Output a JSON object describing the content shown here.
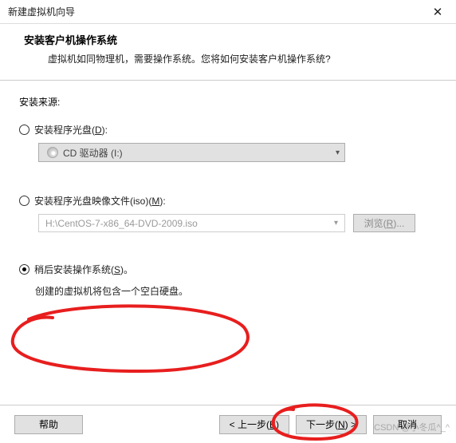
{
  "title": "新建虚拟机向导",
  "header": {
    "heading": "安装客户机操作系统",
    "subhead": "虚拟机如同物理机，需要操作系统。您将如何安装客户机操作系统?"
  },
  "labels": {
    "source": "安装来源:"
  },
  "options": {
    "disc": {
      "label": "安装程序光盘(",
      "mnemonic": "D",
      "suffix": "):"
    },
    "iso": {
      "label": "安装程序光盘映像文件(iso)(",
      "mnemonic": "M",
      "suffix": "):"
    },
    "later": {
      "label": "稍后安装操作系统(",
      "mnemonic": "S",
      "suffix": ")。",
      "desc": "创建的虚拟机将包含一个空白硬盘。"
    }
  },
  "combo": {
    "text": "CD 驱动器 (I:)"
  },
  "path": {
    "value": "H:\\CentOS-7-x86_64-DVD-2009.iso"
  },
  "browse": {
    "label": "浏览(",
    "mnemonic": "R",
    "suffix": ")..."
  },
  "buttons": {
    "help": "帮助",
    "back_pre": "< 上一步(",
    "back_mn": "B",
    "back_suf": ")",
    "next_pre": "下一步(",
    "next_mn": "N",
    "next_suf": ") >",
    "cancel": "取消"
  },
  "watermark": "CSDN @小冬瓜^_^"
}
